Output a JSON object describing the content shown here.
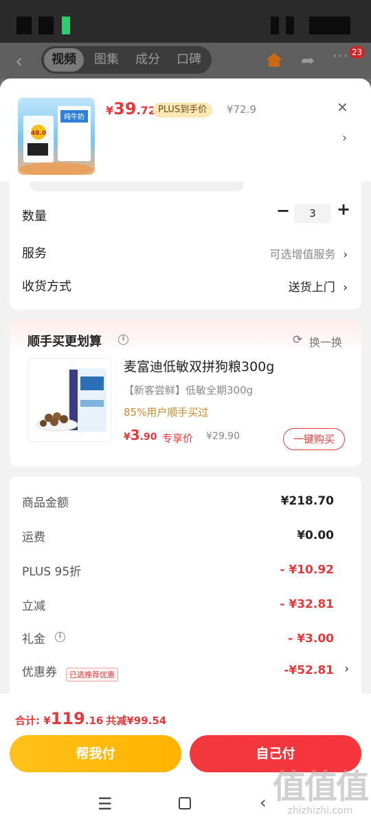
{
  "top_nav": {
    "tabs": [
      {
        "label": "视频",
        "active": true
      },
      {
        "label": "图集",
        "active": false
      },
      {
        "label": "成分",
        "active": false
      },
      {
        "label": "口碑",
        "active": false
      }
    ],
    "cart_badge": "23"
  },
  "product_header": {
    "price_currency": "¥",
    "price_int": "39",
    "price_dec": ".72",
    "plus_tag": "PLUS到手价",
    "orig_price": "¥72.9",
    "thumb_brand_text": "纯牛奶",
    "thumb_price_text": "48.0"
  },
  "options": {
    "quantity_label": "数量",
    "quantity_value": "3",
    "service_label": "服务",
    "service_value": "可选增值服务",
    "delivery_label": "收货方式",
    "delivery_value": "送货上门"
  },
  "upsell": {
    "title": "顺手买更划算",
    "refresh_label": "换一换",
    "item_name": "麦富迪低敏双拼狗粮300g",
    "item_sub": "【新客尝鲜】低敏全期300g",
    "item_stat": "85%用户顺手买过",
    "price_currency": "¥",
    "price_int": "3",
    "price_dec": ".90",
    "price_label": "专享价",
    "orig_price": "¥29.90",
    "buy_button": "一键购买"
  },
  "summary": {
    "rows": [
      {
        "label": "商品金额",
        "value": "¥218.70"
      },
      {
        "label": "运费",
        "value": "¥0.00"
      },
      {
        "label": "PLUS 95折",
        "value": "- ¥10.92"
      },
      {
        "label": "立减",
        "value": "- ¥32.81"
      },
      {
        "label": "礼金",
        "value": "- ¥3.00"
      },
      {
        "label": "优惠券",
        "value": "-¥52.81"
      }
    ],
    "coupon_tag": "已选推荐优惠"
  },
  "footer": {
    "total_label": "合计: ",
    "total_currency": "¥",
    "total_int": "119",
    "total_dec": ".16",
    "saved_text": "共减¥99.54",
    "help_pay_button": "帮我付",
    "self_pay_button": "自己付"
  },
  "watermark": {
    "logo_text": "值值值",
    "site": "zhizhizhi.com"
  },
  "colors": {
    "accent_red": "#e4393c",
    "plus_gold": "#fbe7b8",
    "help_button": "#ffb300"
  }
}
